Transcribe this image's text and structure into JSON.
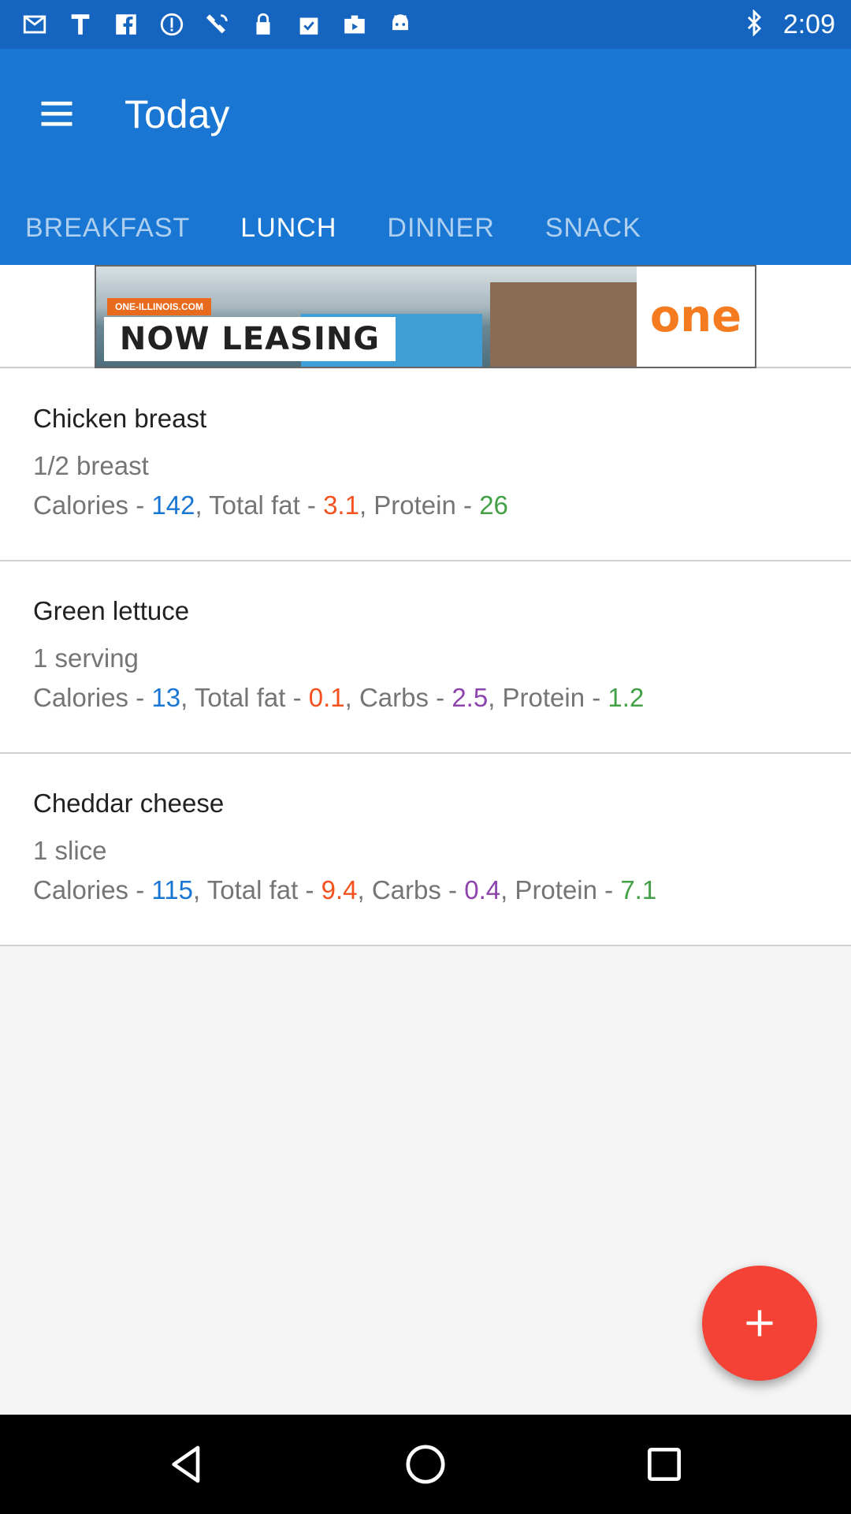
{
  "status_bar": {
    "time": "2:09",
    "left_icons": [
      "mail-icon",
      "t-icon",
      "facebook-icon",
      "info-icon",
      "satellite-icon",
      "lock-icon",
      "clipboard-check-icon",
      "briefcase-icon",
      "android-icon"
    ],
    "right_icons": [
      "bluetooth-icon"
    ]
  },
  "app_bar": {
    "title": "Today",
    "menu_icon": "menu-icon",
    "tabs": [
      {
        "label": "BREAKFAST",
        "active": false
      },
      {
        "label": "LUNCH",
        "active": true
      },
      {
        "label": "DINNER",
        "active": false
      },
      {
        "label": "SNACK",
        "active": false
      }
    ]
  },
  "ad": {
    "url_text": "ONE-ILLINOIS.COM",
    "headline": "NOW LEASING",
    "brand": "one"
  },
  "items": [
    {
      "name": "Chicken breast",
      "serving": "1/2 breast",
      "calories_label": "Calories - ",
      "calories": "142",
      "fat_label": ", Total fat - ",
      "fat": "3.1",
      "carbs_label": "",
      "carbs": "",
      "protein_label": ", Protein - ",
      "protein": "26"
    },
    {
      "name": "Green lettuce",
      "serving": "1 serving",
      "calories_label": "Calories - ",
      "calories": "13",
      "fat_label": ", Total fat - ",
      "fat": "0.1",
      "carbs_label": ", Carbs - ",
      "carbs": "2.5",
      "protein_label": ", Protein - ",
      "protein": "1.2"
    },
    {
      "name": "Cheddar cheese",
      "serving": "1 slice",
      "calories_label": "Calories - ",
      "calories": "115",
      "fat_label": ", Total fat - ",
      "fat": "9.4",
      "carbs_label": ", Carbs - ",
      "carbs": "0.4",
      "protein_label": ", Protein - ",
      "protein": "7.1"
    }
  ],
  "fab": {
    "icon": "plus-icon"
  },
  "nav_bar": {
    "buttons": [
      "back-icon",
      "home-icon",
      "recents-icon"
    ]
  },
  "colors": {
    "status_bar": "#1565c0",
    "app_bar": "#1976d2",
    "calories": "#1976d2",
    "fat": "#f4511e",
    "carbs": "#8e44ad",
    "protein": "#43a047",
    "fab": "#f44336"
  }
}
